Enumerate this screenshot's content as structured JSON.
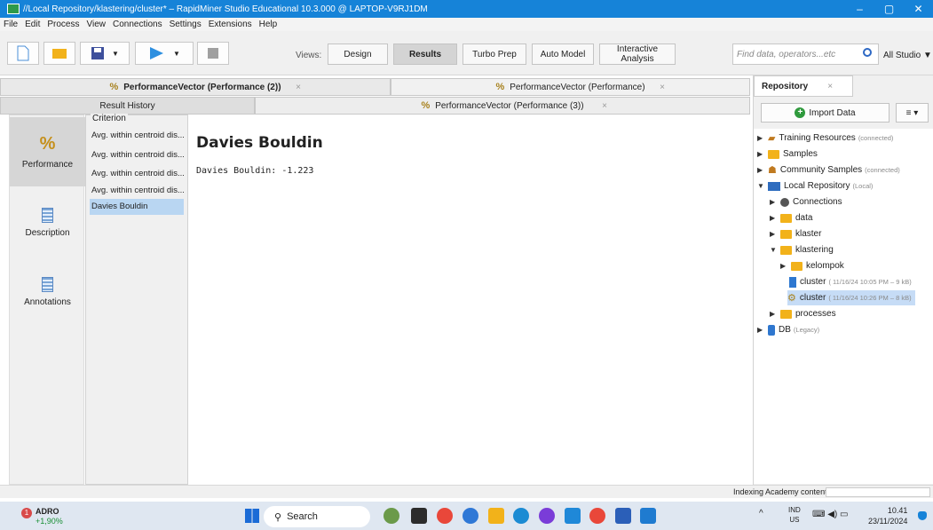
{
  "window": {
    "title": "//Local Repository/klastering/cluster* – RapidMiner Studio Educational 10.3.000 @ LAPTOP-V9RJ1DM",
    "minimize": "–",
    "maximize": "▢",
    "close": "✕"
  },
  "menu": [
    "File",
    "Edit",
    "Process",
    "View",
    "Connections",
    "Settings",
    "Extensions",
    "Help"
  ],
  "toolbar": {
    "views_label": "Views:",
    "view_tabs": [
      "Design",
      "Results",
      "Turbo Prep",
      "Auto Model",
      "Interactive Analysis"
    ],
    "active_view": "Results",
    "search_placeholder": "Find data, operators...etc",
    "scope": "All Studio ▼"
  },
  "result_tabs": {
    "top": [
      {
        "label": "PerformanceVector (Performance (2))"
      },
      {
        "label": "PerformanceVector (Performance)"
      }
    ],
    "bottom": [
      {
        "label": "Result History"
      },
      {
        "label": "PerformanceVector (Performance (3))"
      }
    ],
    "close_glyph": "×"
  },
  "left_nav": [
    {
      "label": "Performance",
      "glyph": "%"
    },
    {
      "label": "Description"
    },
    {
      "label": "Annotations"
    }
  ],
  "criterion": {
    "title": "Criterion",
    "items": [
      "Avg. within centroid dis...",
      "Avg. within centroid dis...",
      "Avg. within centroid dis...",
      "Avg. within centroid dis...",
      "Davies Bouldin"
    ],
    "selected": "Davies Bouldin"
  },
  "content": {
    "heading": "Davies Bouldin",
    "value_text": "Davies Bouldin: -1.223"
  },
  "repository": {
    "tab_label": "Repository",
    "import_label": "Import Data",
    "menu_label": "≡ ▾",
    "tree": [
      {
        "label": "Training Resources",
        "tag": "(connected)"
      },
      {
        "label": "Samples",
        "tag": ""
      },
      {
        "label": "Community Samples",
        "tag": "(connected)"
      },
      {
        "label": "Local Repository",
        "tag": "(Local)"
      },
      {
        "label": "Connections",
        "tag": ""
      },
      {
        "label": "data",
        "tag": ""
      },
      {
        "label": "klaster",
        "tag": ""
      },
      {
        "label": "klastering",
        "tag": ""
      },
      {
        "label": "kelompok",
        "tag": ""
      },
      {
        "label": "cluster",
        "tag": "( 11/16/24 10:05 PM – 9 kB)"
      },
      {
        "label": "cluster",
        "tag": "( 11/16/24 10:26 PM – 8 kB)"
      },
      {
        "label": "processes",
        "tag": ""
      },
      {
        "label": "DB",
        "tag": "(Legacy)"
      }
    ]
  },
  "status": {
    "text": "Indexing Academy content"
  },
  "taskbar": {
    "stock_name": "ADRO",
    "stock_change": "+1,90%",
    "stock_badge": "1",
    "search": "Search",
    "lang_top": "IND",
    "lang_bottom": "US",
    "time": "10.41",
    "date": "23/11/2024",
    "tray_chevron": "^",
    "tray_icons": "⌨ ◀) ▭"
  },
  "colors": {
    "titlebar": "#1683d8",
    "selection": "#b9d6f2",
    "folder": "#f2b21a",
    "performance_icon": "#c58f1a"
  }
}
